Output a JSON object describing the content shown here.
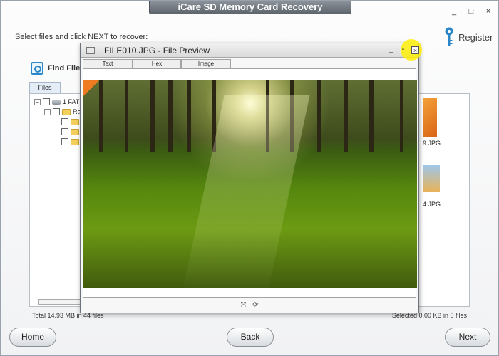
{
  "app": {
    "title": "iCare SD Memory Card Recovery"
  },
  "window_controls": {
    "minimize": "_",
    "maximize": "□",
    "close": "×"
  },
  "instruction": "Select files and click NEXT to recover:",
  "register": {
    "label": "Register",
    "icon": "key-icon"
  },
  "find_file": {
    "label": "Find File",
    "icon": "find-file-icon"
  },
  "tree": {
    "tab_label": "Files",
    "root_label": "1 FAT3",
    "folder_label": "Rav",
    "expander_minus": "−"
  },
  "thumbnails": [
    {
      "label": "9.JPG"
    },
    {
      "label": "4.JPG"
    }
  ],
  "status": {
    "left": "Total 14.93 MB in 44 files",
    "right": "Selected 0.00 KB in 0 files"
  },
  "buttons": {
    "home": "Home",
    "back": "Back",
    "next": "Next"
  },
  "preview": {
    "title": "FILE010.JPG - File Preview",
    "tabs": [
      "Text",
      "Hex",
      "Image"
    ],
    "controls": {
      "minimize": "_",
      "maximize": "▫",
      "close": "×"
    },
    "toolbar": {
      "fit": "⤧",
      "rotate": "⟳"
    }
  },
  "colors": {
    "accent": "#2a86c8",
    "title_bar": "#6f757c",
    "highlight": "#fff000"
  }
}
